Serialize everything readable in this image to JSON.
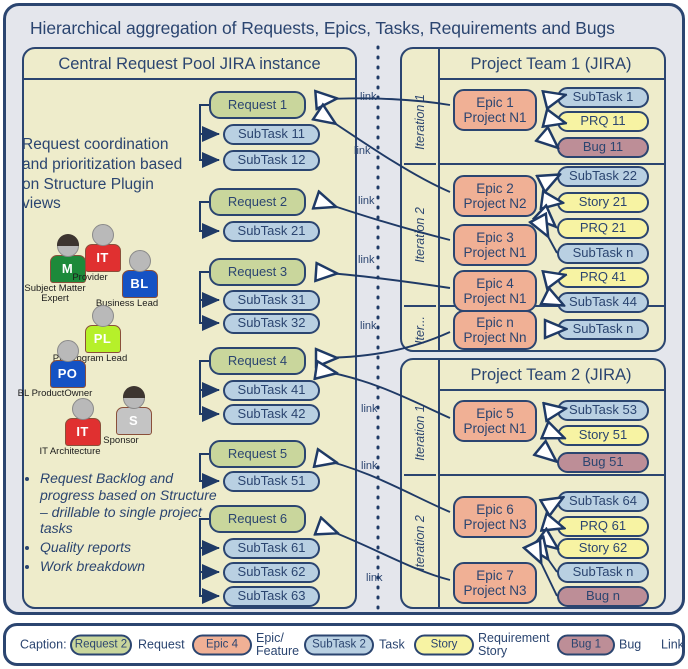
{
  "title": "Hierarchical aggregation of Requests, Epics, Tasks, Requirements and Bugs",
  "colors": {
    "frame": "#2b4570",
    "canvas": "#e4e6ec",
    "panel": "#eeeccb",
    "request": "#c9d69c",
    "subtask": "#b9d0e2",
    "epic": "#f0b095",
    "requirement": "#f7f3a3",
    "bug": "#bd8e97"
  },
  "left_panel": {
    "header": "Central Request Pool JIRA instance",
    "description": "Request coordination and prioritization based on Structure Plugin views",
    "bullets": [
      "Request Backlog and progress based on Structure – drillable to single project tasks",
      "Quality reports",
      "Work breakdown"
    ],
    "people": [
      {
        "initials": "M",
        "label": "Subject Matter Expert",
        "color": "#1d8a3a",
        "hair": true
      },
      {
        "initials": "IT",
        "label": "Provider",
        "color": "#e03030",
        "hair": false
      },
      {
        "initials": "BL",
        "label": "Business Lead",
        "color": "#1552c4",
        "hair": false
      },
      {
        "initials": "PL",
        "label": "PL/Program Lead",
        "color": "#b6f02a",
        "hair": false
      },
      {
        "initials": "PO",
        "label": "BL ProductOwner",
        "color": "#1552c4",
        "hair": false
      },
      {
        "initials": "S",
        "label": "Sponsor",
        "color": "#c4c4c4",
        "hair": true
      },
      {
        "initials": "IT",
        "label": "IT Architecture",
        "color": "#e03030",
        "hair": false
      }
    ],
    "groups": [
      {
        "request": "Request 1",
        "subtasks": [
          "SubTask 11",
          "SubTask 12"
        ]
      },
      {
        "request": "Request 2",
        "subtasks": [
          "SubTask 21"
        ]
      },
      {
        "request": "Request 3",
        "subtasks": [
          "SubTask 31",
          "SubTask 32"
        ]
      },
      {
        "request": "Request 4",
        "subtasks": [
          "SubTask 41",
          "SubTask 42"
        ]
      },
      {
        "request": "Request 5",
        "subtasks": [
          "SubTask 51"
        ]
      },
      {
        "request": "Request 6",
        "subtasks": [
          "SubTask 61",
          "SubTask 62",
          "SubTask 63"
        ]
      }
    ]
  },
  "team1": {
    "header": "Project Team 1 (JIRA)",
    "lanes": [
      "Iteration 1",
      "Iteration 2",
      "Iter..."
    ],
    "epics": [
      {
        "line1": "Epic 1",
        "line2": "Project N1"
      },
      {
        "line1": "Epic 2",
        "line2": "Project N2"
      },
      {
        "line1": "Epic 3",
        "line2": "Project N1"
      },
      {
        "line1": "Epic 4",
        "line2": "Project N1"
      },
      {
        "line1": "Epic n",
        "line2": "Project Nn"
      }
    ],
    "items": [
      {
        "label": "SubTask 1",
        "kind": "subtask"
      },
      {
        "label": "PRQ 11",
        "kind": "prq"
      },
      {
        "label": "Bug 11",
        "kind": "bug"
      },
      {
        "label": "SubTask 22",
        "kind": "subtask"
      },
      {
        "label": "Story 21",
        "kind": "story"
      },
      {
        "label": "PRQ 21",
        "kind": "prq"
      },
      {
        "label": "SubTask n",
        "kind": "subtask"
      },
      {
        "label": "PRQ 41",
        "kind": "prq"
      },
      {
        "label": "SubTask 44",
        "kind": "subtask"
      },
      {
        "label": "SubTask n",
        "kind": "subtask"
      }
    ]
  },
  "team2": {
    "header": "Project Team 2 (JIRA)",
    "lanes": [
      "Iteration 1",
      "Iteration 2"
    ],
    "epics": [
      {
        "line1": "Epic 5",
        "line2": "Project N1"
      },
      {
        "line1": "Epic 6",
        "line2": "Project N3"
      },
      {
        "line1": "Epic 7",
        "line2": "Project N3"
      }
    ],
    "items": [
      {
        "label": "SubTask 53",
        "kind": "subtask"
      },
      {
        "label": "Story 51",
        "kind": "story"
      },
      {
        "label": "Bug 51",
        "kind": "bug"
      },
      {
        "label": "SubTask 64",
        "kind": "subtask"
      },
      {
        "label": "PRQ 61",
        "kind": "prq"
      },
      {
        "label": "Story 62",
        "kind": "story"
      },
      {
        "label": "SubTask n",
        "kind": "subtask"
      },
      {
        "label": "Bug n",
        "kind": "bug"
      }
    ]
  },
  "link_labels": [
    "link",
    "link",
    "link",
    "link",
    "link",
    "link",
    "link",
    "link"
  ],
  "caption": {
    "prefix": "Caption:",
    "entries": [
      {
        "chip": "Request 2",
        "kind": "request",
        "text": "Request"
      },
      {
        "chip": "Epic 4",
        "kind": "epic",
        "text": "Epic/ Feature"
      },
      {
        "chip": "SubTask 2",
        "kind": "subtask",
        "text": "Task"
      },
      {
        "chip": "Story",
        "kind": "story",
        "text": "Requirement Story"
      },
      {
        "chip": "Bug 1",
        "kind": "bug",
        "text": "Bug"
      }
    ],
    "link_text": "Link"
  }
}
